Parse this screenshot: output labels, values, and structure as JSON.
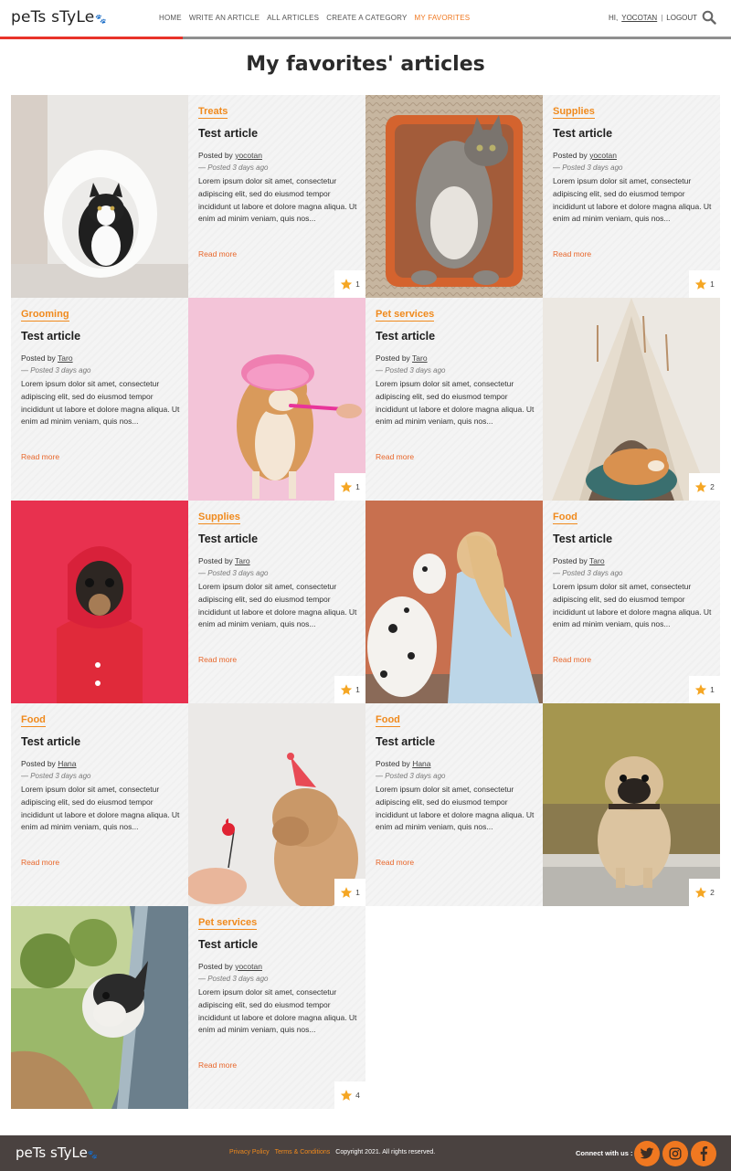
{
  "header": {
    "logo": "peTs sTyLe",
    "nav": [
      "HOME",
      "WRITE AN ARTICLE",
      "ALL ARTICLES",
      "CREATE A CATEGORY",
      "MY FAVORITES"
    ],
    "greeting": "HI,",
    "username": "YOCOTAN",
    "separator": "|",
    "logout": "LOGOUT",
    "active_color": "#f07820"
  },
  "page_title": "My favorites' articles",
  "articles": [
    {
      "category": "Treats",
      "title": "Test article",
      "posted_by": "Posted by",
      "author": "yocotan",
      "date": "— Posted 3 days ago",
      "excerpt": "Lorem ipsum dolor sit amet, consectetur adipiscing elit, sed do eiusmod tempor incididunt ut labore et dolore magna aliqua. Ut enim ad minim veniam, quis nos...",
      "read_more": "Read more",
      "favorites": "1",
      "image": "cat-in-white-tube"
    },
    {
      "category": "Supplies",
      "title": "Test article",
      "posted_by": "Posted by",
      "author": "yocotan",
      "date": "— Posted 3 days ago",
      "excerpt": "Lorem ipsum dolor sit amet, consectetur adipiscing elit, sed do eiusmod tempor incididunt ut labore et dolore magna aliqua. Ut enim ad minim veniam, quis nos...",
      "read_more": "Read more",
      "favorites": "1",
      "image": "tabby-cat-in-basket"
    },
    {
      "category": "Grooming",
      "title": "Test article",
      "posted_by": "Posted by",
      "author": "Taro",
      "date": "— Posted 3 days ago",
      "excerpt": "Lorem ipsum dolor sit amet, consectetur adipiscing elit, sed do eiusmod tempor incididunt ut labore et dolore magna aliqua. Ut enim ad minim veniam, quis nos...",
      "read_more": "Read more",
      "favorites": "1",
      "image": "shiba-shower-cap"
    },
    {
      "category": "Pet services",
      "title": "Test article",
      "posted_by": "Posted by",
      "author": "Taro",
      "date": "— Posted 3 days ago",
      "excerpt": "Lorem ipsum dolor sit amet, consectetur adipiscing elit, sed do eiusmod tempor incididunt ut labore et dolore magna aliqua. Ut enim ad minim veniam, quis nos...",
      "read_more": "Read more",
      "favorites": "2",
      "image": "shiba-in-teepee"
    },
    {
      "category": "Supplies",
      "title": "Test article",
      "posted_by": "Posted by",
      "author": "Taro",
      "date": "— Posted 3 days ago",
      "excerpt": "Lorem ipsum dolor sit amet, consectetur adipiscing elit, sed do eiusmod tempor incididunt ut labore et dolore magna aliqua. Ut enim ad minim veniam, quis nos...",
      "read_more": "Read more",
      "favorites": "1",
      "image": "dog-red-hoodie"
    },
    {
      "category": "Food",
      "title": "Test article",
      "posted_by": "Posted by",
      "author": "Taro",
      "date": "— Posted 3 days ago",
      "excerpt": "Lorem ipsum dolor sit amet, consectetur adipiscing elit, sed do eiusmod tempor incididunt ut labore et dolore magna aliqua. Ut enim ad minim veniam, quis nos...",
      "read_more": "Read more",
      "favorites": "1",
      "image": "woman-dalmatian"
    },
    {
      "category": "Food",
      "title": "Test article",
      "posted_by": "Posted by",
      "author": "Hana",
      "date": "— Posted 3 days ago",
      "excerpt": "Lorem ipsum dolor sit amet, consectetur adipiscing elit, sed do eiusmod tempor incididunt ut labore et dolore magna aliqua. Ut enim ad minim veniam, quis nos...",
      "read_more": "Read more",
      "favorites": "1",
      "image": "sharpei-party-hat"
    },
    {
      "category": "Food",
      "title": "Test article",
      "posted_by": "Posted by",
      "author": "Hana",
      "date": "— Posted 3 days ago",
      "excerpt": "Lorem ipsum dolor sit amet, consectetur adipiscing elit, sed do eiusmod tempor incididunt ut labore et dolore magna aliqua. Ut enim ad minim veniam, quis nos...",
      "read_more": "Read more",
      "favorites": "2",
      "image": "pug-sitting"
    },
    {
      "category": "Pet services",
      "title": "Test article",
      "posted_by": "Posted by",
      "author": "yocotan",
      "date": "— Posted 3 days ago",
      "excerpt": "Lorem ipsum dolor sit amet, consectetur adipiscing elit, sed do eiusmod tempor incididunt ut labore et dolore magna aliqua. Ut enim ad minim veniam, quis nos...",
      "read_more": "Read more",
      "favorites": "4",
      "image": "boston-terrier-car-window"
    }
  ],
  "footer": {
    "logo": "peTs sTyLe",
    "privacy": "Privacy Policy",
    "terms": "Terms & Conditions",
    "copyright": "Copyright 2021. All rights reserved.",
    "connect": "Connect with us :",
    "social_icons": [
      "twitter-icon",
      "instagram-icon",
      "facebook-icon"
    ],
    "accent": "#f07820",
    "background": "#4a4240"
  }
}
